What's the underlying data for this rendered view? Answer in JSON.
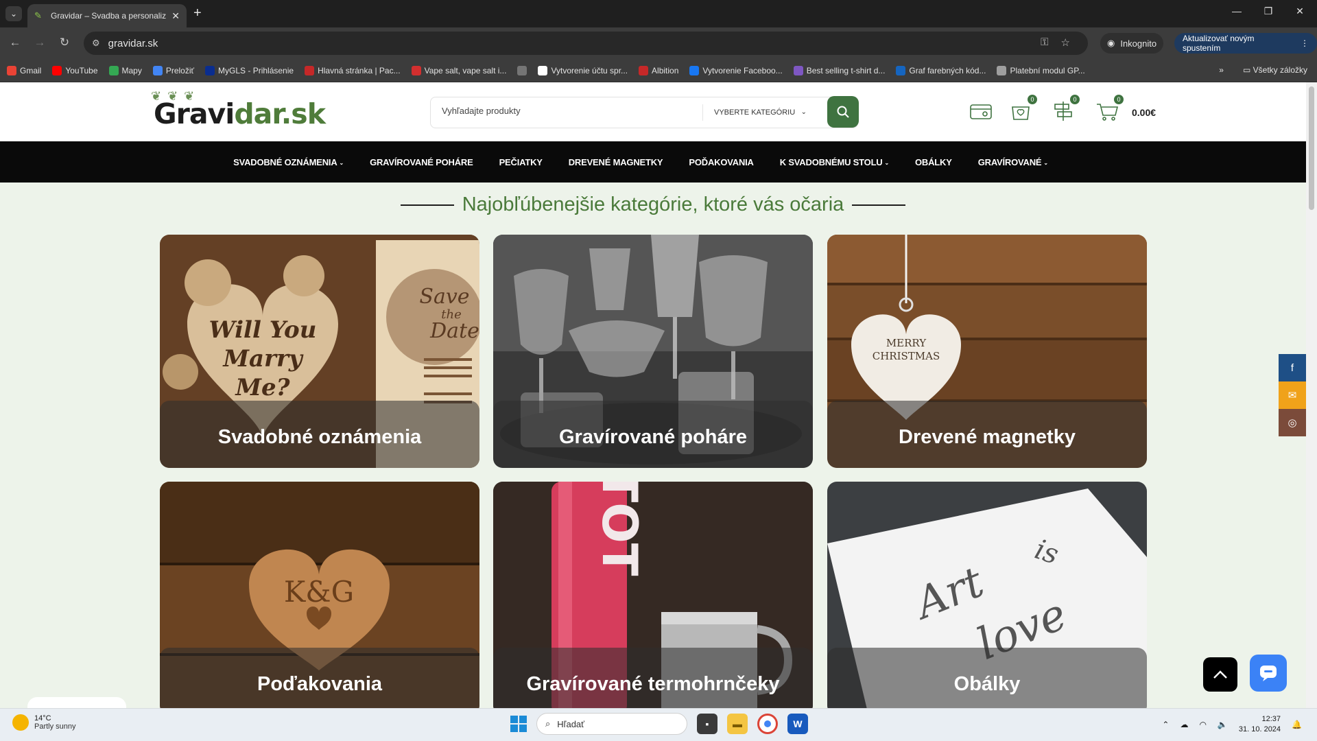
{
  "browser": {
    "tab_title": "Gravidar – Svadba a personalizované",
    "url": "gravidar.sk",
    "incognito_label": "Inkognito",
    "update_label": "Aktualizovať novým spustením",
    "all_bookmarks": "Všetky záložky",
    "bookmarks": [
      {
        "label": "Gmail",
        "color": "#ea4335"
      },
      {
        "label": "YouTube",
        "color": "#ff0000"
      },
      {
        "label": "Mapy",
        "color": "#34a853"
      },
      {
        "label": "Preložiť",
        "color": "#4285f4"
      },
      {
        "label": "MyGLS - Prihlásenie",
        "color": "#0a2d8f"
      },
      {
        "label": "Hlavná stránka | Pac...",
        "color": "#c62828"
      },
      {
        "label": "Vape salt, vape salt i...",
        "color": "#d32f2f"
      },
      {
        "label": "",
        "color": "#757575"
      },
      {
        "label": "Vytvorenie účtu spr...",
        "color": "#ffffff"
      },
      {
        "label": "Albition",
        "color": "#c62828"
      },
      {
        "label": "Vytvorenie Faceboo...",
        "color": "#1877f2"
      },
      {
        "label": "Best selling t-shirt d...",
        "color": "#7e57c2"
      },
      {
        "label": "Graf farebných kód...",
        "color": "#1565c0"
      },
      {
        "label": "Platební modul GP...",
        "color": "#9e9e9e"
      }
    ]
  },
  "site": {
    "logo_dark": "Gravi",
    "logo_green": "dar.sk",
    "search_placeholder": "Vyhľadajte produkty",
    "category_select": "VYBERTE KATEGÓRIU",
    "wishlist_count": "0",
    "compare_count": "0",
    "cart_count": "0",
    "cart_total": "0.00€",
    "menu": [
      {
        "label": "SVADOBNÉ OZNÁMENIA",
        "dropdown": true
      },
      {
        "label": "GRAVÍROVANÉ POHÁRE",
        "dropdown": false
      },
      {
        "label": "PEČIATKY",
        "dropdown": false
      },
      {
        "label": "DREVENÉ MAGNETKY",
        "dropdown": false
      },
      {
        "label": "POĎAKOVANIA",
        "dropdown": false
      },
      {
        "label": "K SVADOBNÉMU STOLU",
        "dropdown": true
      },
      {
        "label": "OBÁLKY",
        "dropdown": false
      },
      {
        "label": "GRAVÍROVANÉ",
        "dropdown": true
      }
    ],
    "section_title": "Najobľúbenejšie kategórie, ktoré vás očaria",
    "categories": [
      {
        "label": "Svadobné oznámenia"
      },
      {
        "label": "Gravírované poháre"
      },
      {
        "label": "Drevené magnetky"
      },
      {
        "label": "Poďakovania"
      },
      {
        "label": "Gravírované termohrnčeky"
      },
      {
        "label": "Obálky"
      }
    ],
    "colors": {
      "accent": "#3f7340",
      "title_green": "#4a7a3a",
      "facebook": "#1e4f86",
      "email": "#f0a21a",
      "instagram": "#7b4b3a"
    }
  },
  "taskbar": {
    "temp": "14°C",
    "weather": "Partly sunny",
    "search": "Hľadať",
    "time": "12:37",
    "date": "31. 10. 2024"
  }
}
